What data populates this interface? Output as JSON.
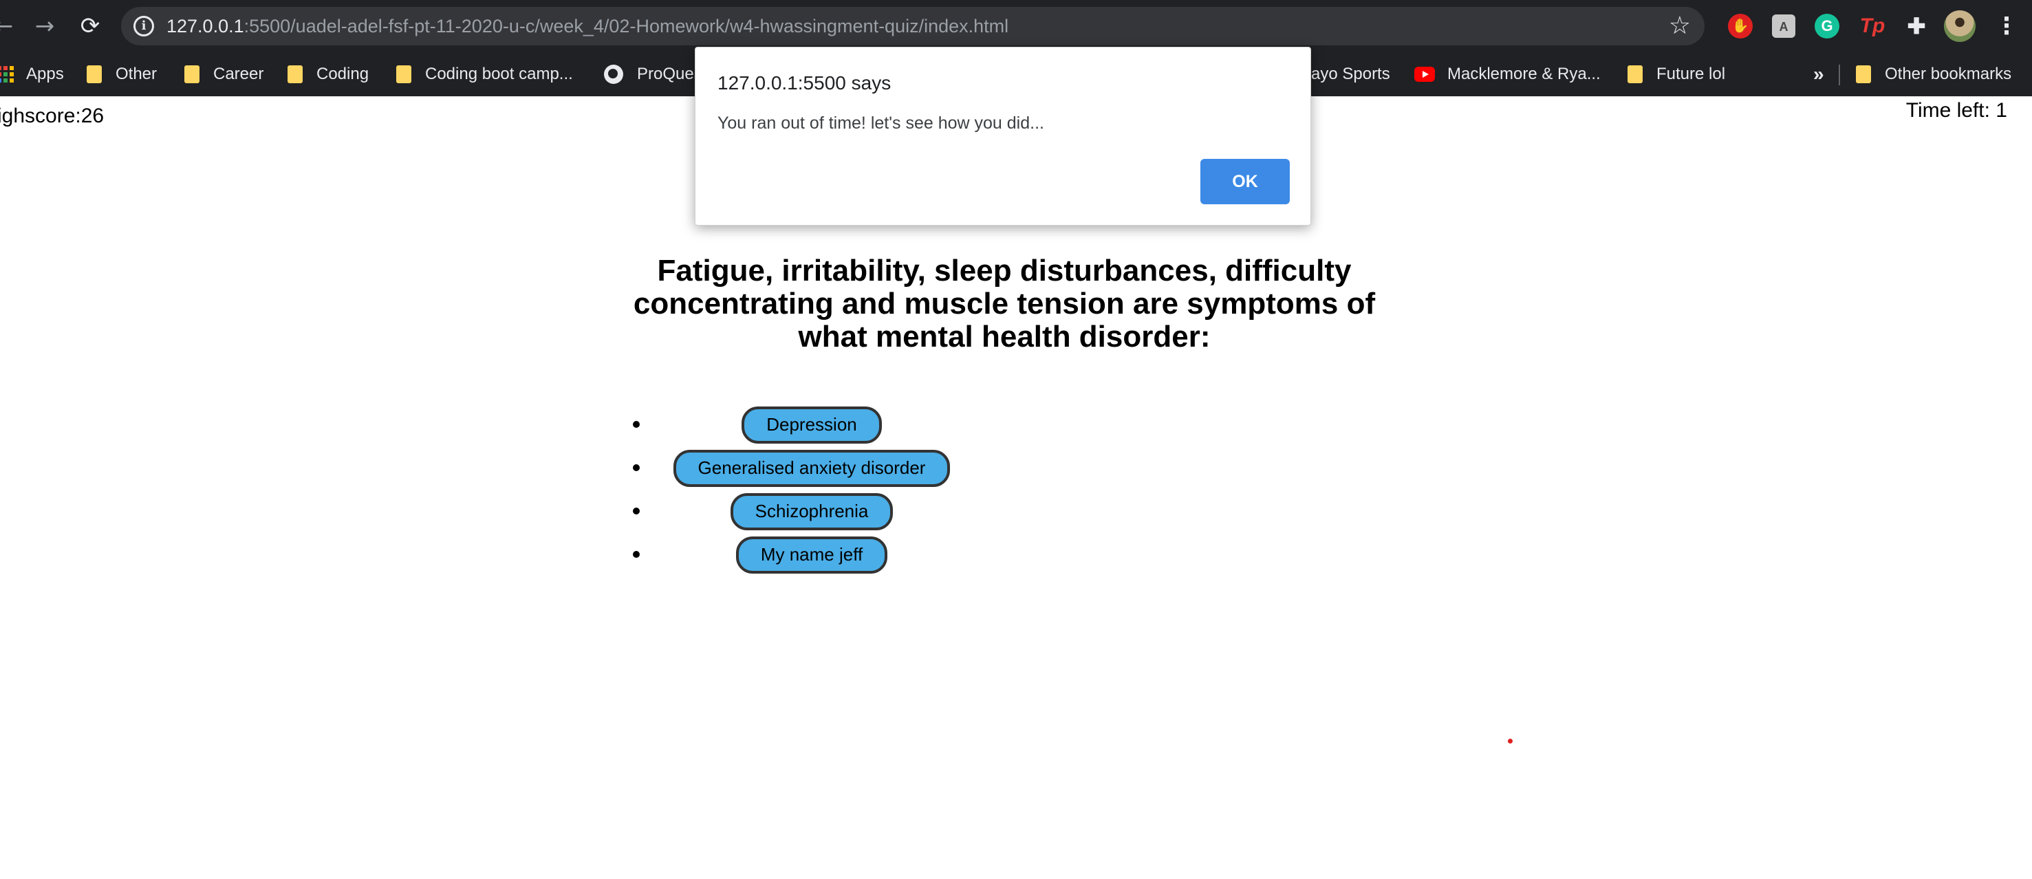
{
  "browser": {
    "url_host": "127.0.0.1",
    "url_path": ":5500/uadel-adel-fsf-pt-11-2020-u-c/week_4/02-Homework/w4-hwassingment-quiz/index.html",
    "extensions": {
      "red": "✋",
      "gray": "A",
      "green": "G",
      "tp": "Tp"
    },
    "bookmarks": [
      {
        "label": "Apps",
        "icon": "apps-grid-icon"
      },
      {
        "label": "Other",
        "icon": "folder-icon"
      },
      {
        "label": "Career",
        "icon": "folder-icon"
      },
      {
        "label": "Coding",
        "icon": "folder-icon"
      },
      {
        "label": "Coding boot camp...",
        "icon": "folder-icon"
      },
      {
        "label": "ProQues",
        "icon": "globe-icon"
      },
      {
        "label": "ayo Sports",
        "icon": "none"
      },
      {
        "label": "Macklemore & Rya...",
        "icon": "youtube-icon"
      },
      {
        "label": "Future lol",
        "icon": "folder-icon"
      },
      {
        "label": "»",
        "icon": "chevron-double-icon"
      },
      {
        "label": "Other bookmarks",
        "icon": "folder-icon"
      }
    ]
  },
  "page": {
    "highscore": "ighscore:26",
    "time_left": "Time left: 1",
    "question": "Fatigue, irritability, sleep disturbances, difficulty concentrating and muscle tension are symptoms of what mental health disorder:",
    "answers": [
      "Depression",
      "Generalised anxiety disorder",
      "Schizophrenia",
      "My name jeff"
    ]
  },
  "dialog": {
    "title": "127.0.0.1:5500 says",
    "message": "You ran out of time! let's see how you did...",
    "ok_label": "OK"
  },
  "colors": {
    "chrome_bg": "#202124",
    "omnibox_bg": "#35363a",
    "answer_button_bg": "#4aaee8",
    "ok_button_bg": "#3c8ae6",
    "folder": "#fdd663"
  }
}
